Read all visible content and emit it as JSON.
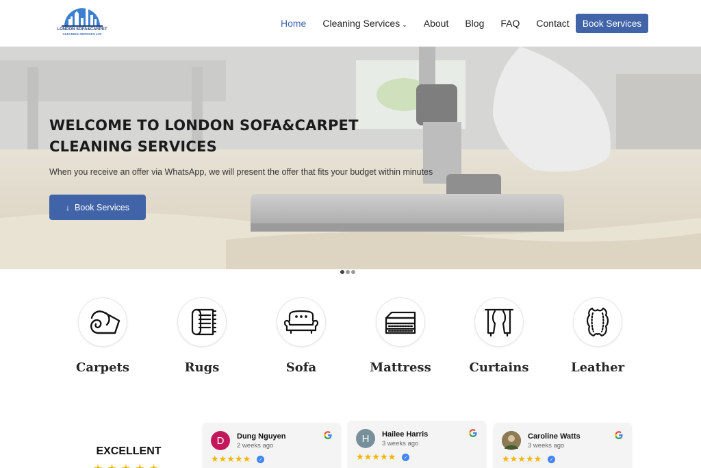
{
  "header": {
    "logo_text": "LONDON SOFA&CARPET",
    "logo_subtext": "CLEANING SERVICES LTD",
    "nav": [
      {
        "label": "Home",
        "active": true
      },
      {
        "label": "Cleaning Services",
        "has_dropdown": true
      },
      {
        "label": "About"
      },
      {
        "label": "Blog"
      },
      {
        "label": "FAQ"
      },
      {
        "label": "Contact"
      }
    ],
    "book_button": "Book Services"
  },
  "hero": {
    "title": "WELCOME TO LONDON SOFA&CARPET CLEANING SERVICES",
    "subtitle": "When you receive an offer via WhatsApp, we will present the offer that fits your budget within minutes",
    "button": "Book Services",
    "button_icon": "arrow-down-icon",
    "slides": 3,
    "active_slide": 1
  },
  "services": [
    {
      "label": "Carpets",
      "icon": "carpet-roll-icon"
    },
    {
      "label": "Rugs",
      "icon": "rug-icon"
    },
    {
      "label": "Sofa",
      "icon": "sofa-icon"
    },
    {
      "label": "Mattress",
      "icon": "mattress-icon"
    },
    {
      "label": "Curtains",
      "icon": "curtains-icon"
    },
    {
      "label": "Leather",
      "icon": "leather-icon"
    }
  ],
  "reviews_summary": {
    "rating_text": "EXCELLENT",
    "stars": 5
  },
  "reviews": [
    {
      "name": "Dung Nguyen",
      "time": "2 weeks ago",
      "initial": "D",
      "avatar_color": "#c2185b",
      "stars": 5
    },
    {
      "name": "Hailee Harris",
      "time": "3 weeks ago",
      "initial": "H",
      "avatar_color": "#78909c",
      "stars": 5
    },
    {
      "name": "Caroline Watts",
      "time": "3 weeks ago",
      "initial": "",
      "avatar_color": "#6d5a3c",
      "stars": 5
    }
  ],
  "colors": {
    "accent": "#4164a8",
    "nav_active": "#3a66b0",
    "star": "#f4b400"
  }
}
